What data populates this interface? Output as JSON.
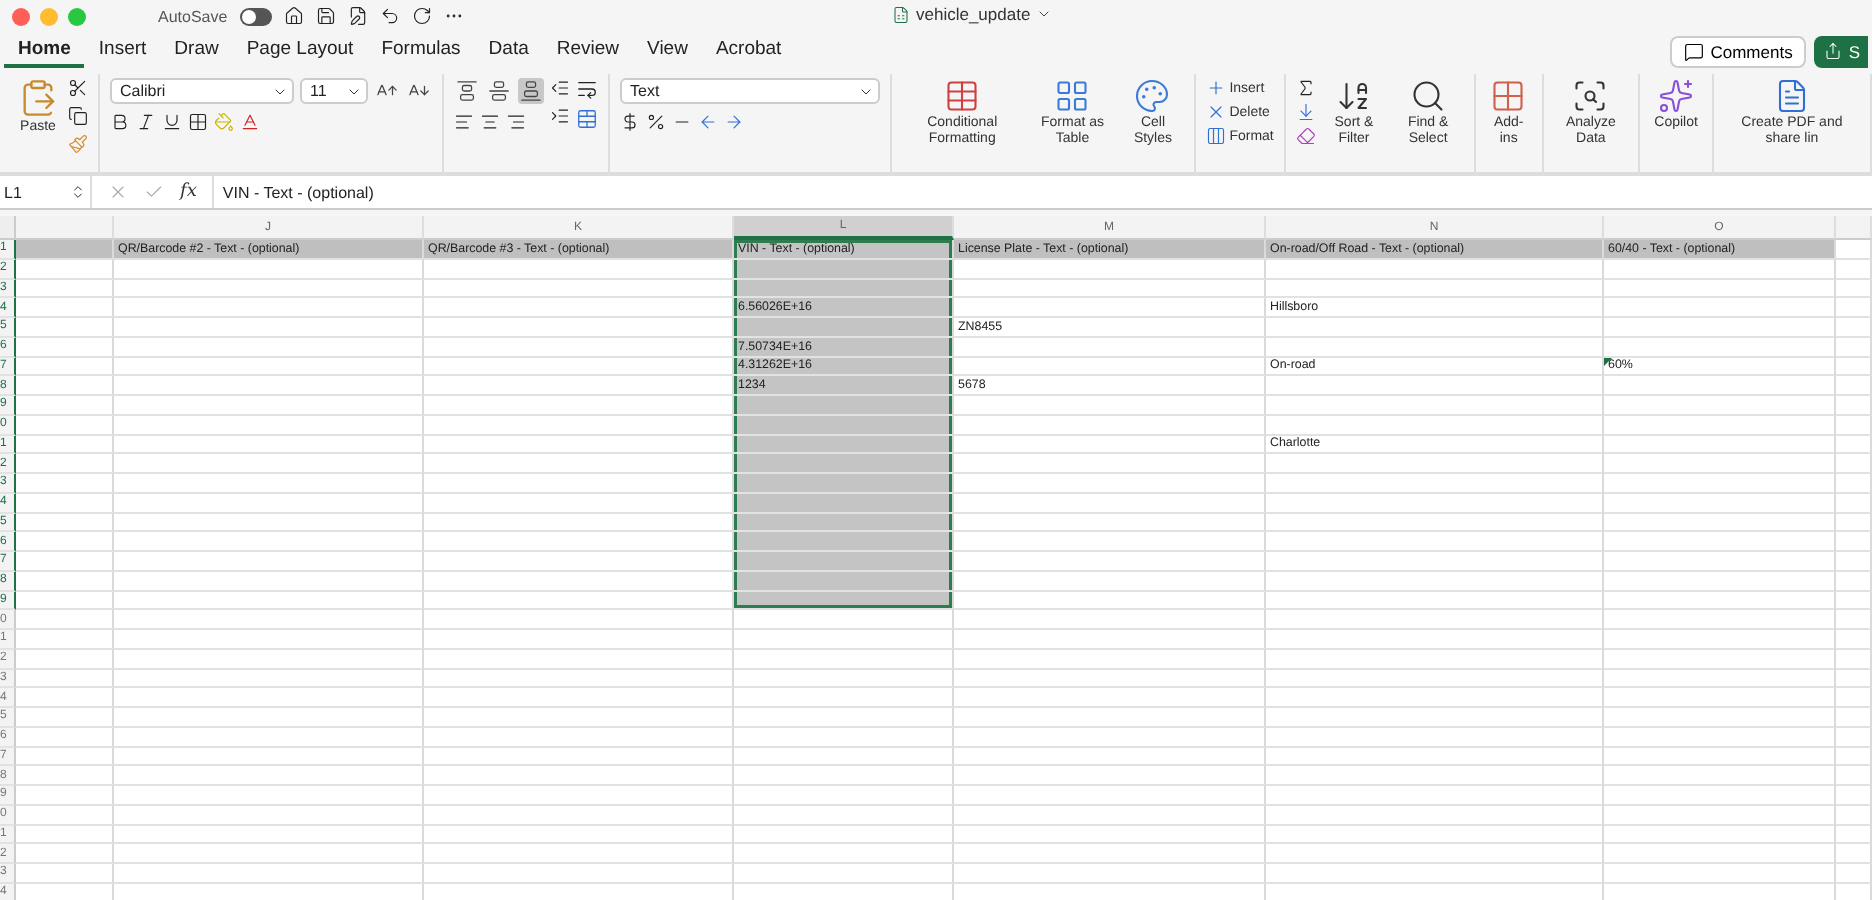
{
  "window": {
    "title": "vehicle_update",
    "autosave": {
      "label": "AutoSave",
      "on": false
    }
  },
  "tabs": [
    {
      "label": "Home",
      "selected": true
    },
    {
      "label": "Insert",
      "selected": false
    },
    {
      "label": "Draw",
      "selected": false
    },
    {
      "label": "Page Layout",
      "selected": false
    },
    {
      "label": "Formulas",
      "selected": false
    },
    {
      "label": "Data",
      "selected": false
    },
    {
      "label": "Review",
      "selected": false
    },
    {
      "label": "View",
      "selected": false
    },
    {
      "label": "Acrobat",
      "selected": false
    }
  ],
  "header_buttons": {
    "comments": "Comments",
    "share": "S"
  },
  "ribbon": {
    "paste": "Paste",
    "font_name": "Calibri",
    "font_size": "11",
    "number_format": "Text",
    "vertical_align": [
      {
        "kind": "top",
        "selected": false
      },
      {
        "kind": "middle",
        "selected": false
      },
      {
        "kind": "bottom",
        "selected": true
      }
    ],
    "styles": [
      {
        "kind": "conditional",
        "label": "Conditional Formatting"
      },
      {
        "kind": "table",
        "label": "Format as Table"
      },
      {
        "kind": "cell",
        "label": "Cell Styles"
      }
    ],
    "cells": [
      {
        "kind": "insert",
        "label": "Insert"
      },
      {
        "kind": "delete",
        "label": "Delete"
      },
      {
        "kind": "format",
        "label": "Format"
      }
    ],
    "editing": [
      {
        "kind": "sort",
        "label": "Sort & Filter"
      },
      {
        "kind": "find",
        "label": "Find & Select"
      }
    ],
    "tools": [
      {
        "kind": "addins",
        "label": "Add-ins"
      },
      {
        "kind": "analyze",
        "label": "Analyze Data"
      },
      {
        "kind": "copilot",
        "label": "Copilot"
      },
      {
        "kind": "pdf",
        "label": "Create PDF and share lin"
      }
    ]
  },
  "formula_bar": {
    "name_box": "L1",
    "fx": "fx",
    "formula": "VIN - Text - (optional)"
  },
  "sheet": {
    "columns": [
      {
        "selected": false
      },
      {
        "label": "J",
        "selected": false
      },
      {
        "label": "K",
        "selected": false
      },
      {
        "label": "L",
        "selected": true
      },
      {
        "label": "M",
        "selected": false
      },
      {
        "label": "N",
        "selected": false
      },
      {
        "label": "O",
        "selected": false
      },
      {
        "selected": false
      }
    ],
    "rows": [
      {
        "number": "1",
        "kind": "header",
        "selected": true,
        "cells": [
          {},
          {
            "text": "QR/Barcode #2 - Text - (optional)"
          },
          {
            "text": "QR/Barcode #3 - Text - (optional)"
          },
          {
            "text": "VIN - Text - (optional)"
          },
          {
            "text": "License Plate - Text - (optional)"
          },
          {
            "text": "On-road/Off Road - Text - (optional)"
          },
          {
            "text": "60/40 - Text - (optional)"
          }
        ]
      },
      {
        "number": "2",
        "kind": "data",
        "selected": true
      },
      {
        "number": "3",
        "kind": "data",
        "selected": true
      },
      {
        "number": "4",
        "kind": "data",
        "selected": true,
        "cells": [
          {},
          {},
          {},
          {
            "text": "6.56026E+16"
          },
          {},
          {
            "text": "Hillsboro"
          }
        ]
      },
      {
        "number": "5",
        "kind": "data",
        "selected": true,
        "cells": [
          {},
          {},
          {},
          {},
          {
            "text": "ZN8455"
          }
        ]
      },
      {
        "number": "6",
        "kind": "data",
        "selected": true,
        "cells": [
          {},
          {},
          {},
          {
            "text": "7.50734E+16"
          }
        ]
      },
      {
        "number": "7",
        "kind": "data",
        "selected": true,
        "cells": [
          {},
          {},
          {},
          {
            "text": "4.31262E+16"
          },
          {},
          {
            "text": "On-road"
          },
          {
            "text": "60%",
            "error_flag": true
          }
        ]
      },
      {
        "number": "8",
        "kind": "data",
        "selected": true,
        "cells": [
          {},
          {},
          {},
          {
            "text": "1234"
          },
          {
            "text": "5678"
          }
        ]
      },
      {
        "number": "9",
        "kind": "data",
        "selected": true
      },
      {
        "number": "0",
        "kind": "data",
        "selected": true
      },
      {
        "number": "1",
        "kind": "data",
        "selected": true,
        "cells": [
          {},
          {},
          {},
          {},
          {},
          {
            "text": "Charlotte"
          }
        ]
      },
      {
        "number": "2",
        "kind": "data",
        "selected": true
      },
      {
        "number": "3",
        "kind": "data",
        "selected": true
      },
      {
        "number": "4",
        "kind": "data",
        "selected": true
      },
      {
        "number": "5",
        "kind": "data",
        "selected": true
      },
      {
        "number": "6",
        "kind": "data",
        "selected": true
      },
      {
        "number": "7",
        "kind": "data",
        "selected": true
      },
      {
        "number": "8",
        "kind": "data",
        "selected": true
      },
      {
        "number": "9",
        "kind": "data",
        "selected": true
      },
      {
        "number": "0",
        "kind": "data",
        "selected": false
      },
      {
        "number": "1",
        "kind": "data",
        "selected": false
      },
      {
        "number": "2",
        "kind": "data",
        "selected": false
      },
      {
        "number": "3",
        "kind": "data",
        "selected": false
      },
      {
        "number": "4",
        "kind": "data",
        "selected": false
      },
      {
        "number": "5",
        "kind": "data",
        "selected": false
      },
      {
        "number": "6",
        "kind": "data",
        "selected": false
      },
      {
        "number": "7",
        "kind": "data",
        "selected": false
      },
      {
        "number": "8",
        "kind": "data",
        "selected": false
      },
      {
        "number": "9",
        "kind": "data",
        "selected": false
      },
      {
        "number": "0",
        "kind": "data",
        "selected": false
      },
      {
        "number": "1",
        "kind": "data",
        "selected": false
      },
      {
        "number": "2",
        "kind": "data",
        "selected": false
      },
      {
        "number": "3",
        "kind": "data",
        "selected": false
      },
      {
        "number": "4",
        "kind": "data",
        "selected": false
      }
    ]
  }
}
